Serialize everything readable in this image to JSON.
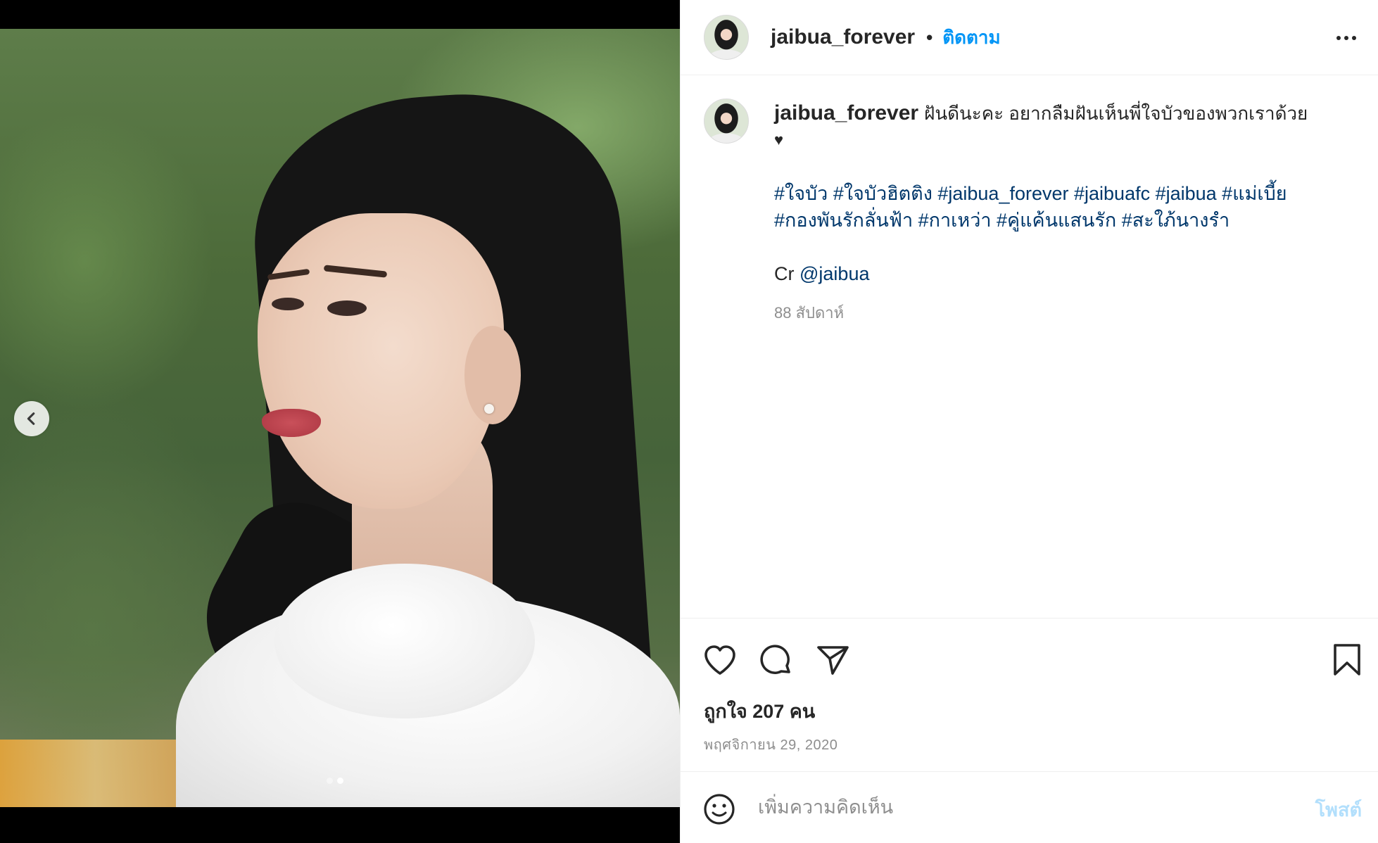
{
  "post": {
    "username": "jaibua_forever",
    "separator": "•",
    "follow_label": "ติดตาม",
    "caption_user": "jaibua_forever",
    "caption_text": "ฝันดีนะคะ อยากลืมฝันเห็นพี่ใจบัวของพวกเราด้วย",
    "caption_emoji": "♥",
    "hashtags": "#ใจบัว #ใจบัวฮิตติง #jaibua_forever #jaibuafc #jaibua #แม่เบี้ย #กองพันรักลั่นฟ้า #กาเหว่า #คู่แค้นแสนรัก #สะใภ้นางรำ",
    "credit_prefix": "Cr ",
    "credit_mention": "@jaibua",
    "age": "88 สัปดาห์",
    "likes": "ถูกใจ 207 คน",
    "date": "พฤศจิกายน 29, 2020"
  },
  "carousel": {
    "total": 2,
    "active_index": 1
  },
  "comment": {
    "placeholder": "เพิ่มความคิดเห็น",
    "post_label": "โพสต์"
  },
  "icons": {
    "prev": "chevron-left-icon",
    "like": "heart-outline-icon",
    "comment": "comment-bubble-icon",
    "share": "paper-plane-icon",
    "save": "bookmark-icon",
    "emoji": "smiley-icon",
    "more": "more-horizontal-icon"
  },
  "colors": {
    "accent": "#0095f6",
    "link": "#00376b",
    "muted": "#8e8e8e",
    "post_disabled": "#b2dffc"
  }
}
